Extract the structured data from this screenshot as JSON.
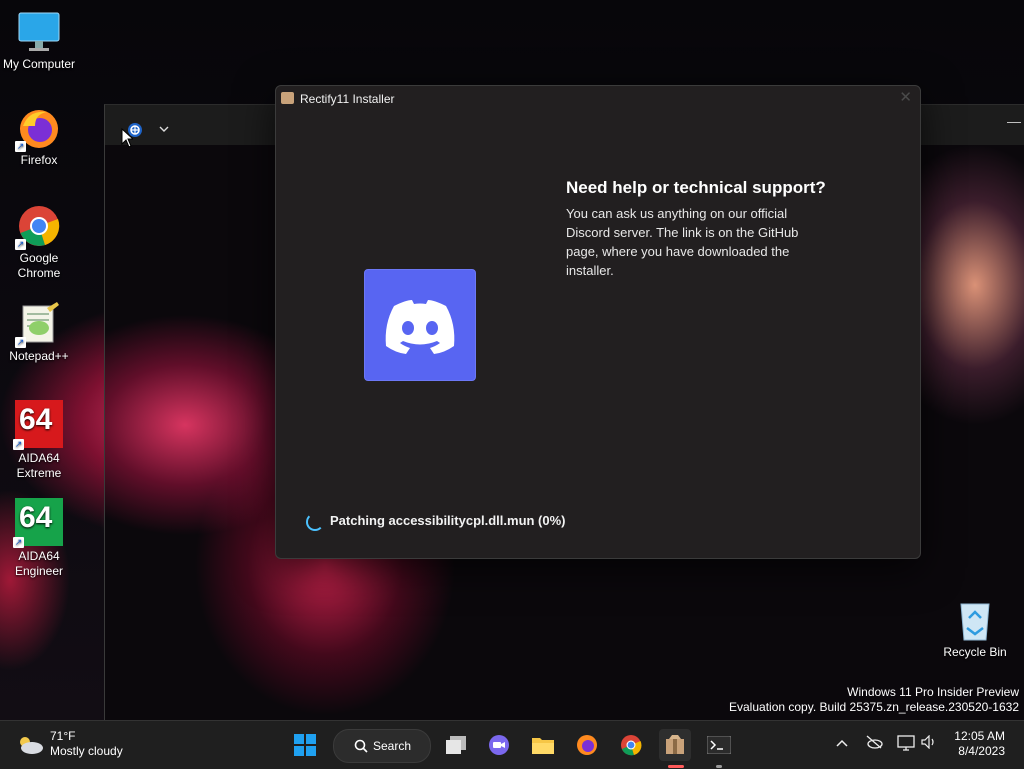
{
  "desktop": {
    "icons": [
      {
        "label": "My Computer"
      },
      {
        "label": "Firefox"
      },
      {
        "label": "Google Chrome"
      },
      {
        "label": "Notepad++"
      },
      {
        "label": "AIDA64 Extreme"
      },
      {
        "label": "AIDA64 Engineer"
      },
      {
        "label": "Recycle Bin"
      }
    ],
    "aida_badge": "64",
    "watermark": {
      "line1": "Windows 11 Pro Insider Preview",
      "line2": "Evaluation copy. Build 25375.zn_release.230520-1632"
    }
  },
  "installer": {
    "title": "Rectify11 Installer",
    "close_glyph": "✕",
    "help_heading": "Need help or technical support?",
    "help_text": "You can ask us anything on our official Discord server. The link is on the GitHub page, where you have downloaded the installer.",
    "status": "Patching accessibilitycpl.dll.mun (0%)",
    "progress_percent": 0
  },
  "taskbar": {
    "weather_temp": "71°F",
    "weather_desc": "Mostly cloudy",
    "search_label": "Search",
    "time": "12:05 AM",
    "date": "8/4/2023"
  },
  "colors": {
    "discord": "#5865f2",
    "accent": "#4cc2ff",
    "taskbar": "#1f1f1f",
    "dialog": "#221f20"
  }
}
